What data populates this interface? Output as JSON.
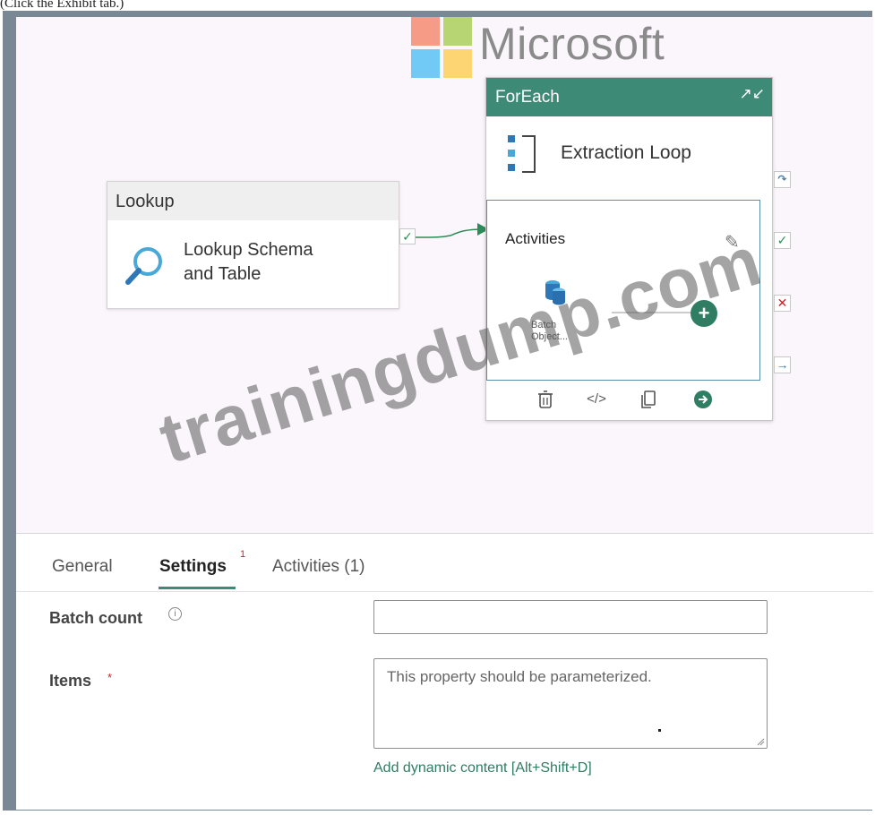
{
  "caption": "(Click the Exhibit tab.)",
  "logo": {
    "text": "Microsoft",
    "colors": [
      "#f25022",
      "#7fba00",
      "#00a4ef",
      "#ffb900"
    ]
  },
  "watermark": "trainingdump.com",
  "lookup": {
    "type": "Lookup",
    "name": "Lookup Schema\nand Table",
    "search_icon": "search-icon",
    "success_icon": "checkmark-icon"
  },
  "foreach": {
    "type": "ForEach",
    "name": "Extraction Loop",
    "activities_title": "Activities",
    "inner_activity_label": "Batch\nObject...",
    "accent_color": "#3d8a77",
    "toolbar": {
      "delete": "delete-icon",
      "code": "</>",
      "copy": "copy-icon",
      "go": "arrow-right-icon"
    },
    "side_icons": [
      "skipped-icon",
      "success-icon",
      "failure-icon",
      "completion-icon"
    ]
  },
  "tabs": [
    {
      "label": "General",
      "active": false
    },
    {
      "label": "Settings",
      "active": true,
      "badge": "1"
    },
    {
      "label": "Activities (1)",
      "active": false
    }
  ],
  "settings": {
    "batch_count_label": "Batch count",
    "batch_count_value": "",
    "items_label": "Items",
    "items_required_marker": "*",
    "items_placeholder": "This property should be parameterized.",
    "dynamic_content_link": "Add dynamic content [Alt+Shift+D]"
  }
}
